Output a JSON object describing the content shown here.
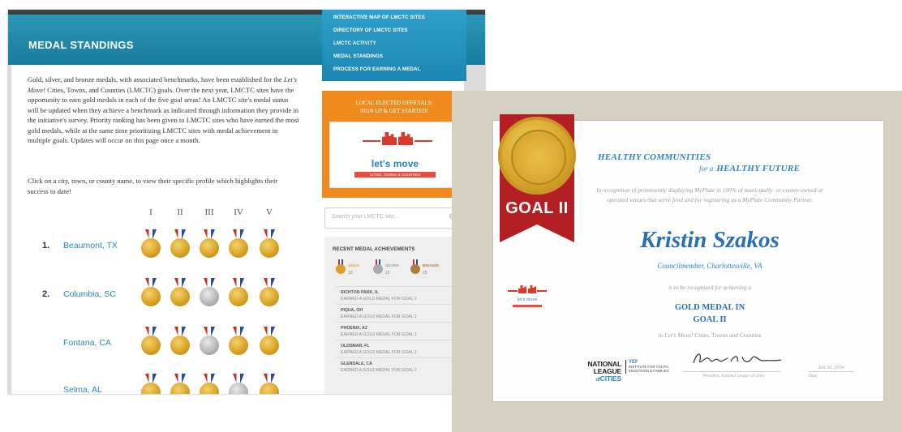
{
  "site": {
    "page_title": "MEDAL STANDINGS",
    "intro_before_italic": "Gold, silver, and bronze medals, with associated benchmarks, have been established for the ",
    "intro_italic": "Let's Move!",
    "intro_after_italic": " Cities, Towns, and Counties (LMCTC) goals. Over the next year, LMCTC sites have the opportunity to earn gold medals in each of the five goal areas! An LMCTC site's medal status will be updated when they achieve a benchmark as indicated through information they provide in the initiative's survey. Priority ranking has been given to LMCTC sites who have earned the most gold medals, while at the same time prioritizing LMCTC sites with medal achievement in multiple goals. Updates will occur on this page once a month.",
    "click_note": "Click on a city, town, or county name, to view their specific profile which highlights their success to date!",
    "goal_columns": [
      "I",
      "II",
      "III",
      "IV",
      "V"
    ],
    "standings": [
      {
        "rank": "1.",
        "place": "Beaumont, TX",
        "medals": [
          "gold",
          "gold",
          "gold",
          "gold",
          "gold"
        ]
      },
      {
        "rank": "2.",
        "place": "Columbia, SC",
        "medals": [
          "gold",
          "gold",
          "silver",
          "gold",
          "gold"
        ]
      },
      {
        "rank": "",
        "place": "Fontana, CA",
        "medals": [
          "gold",
          "gold",
          "silver",
          "gold",
          "gold"
        ]
      },
      {
        "rank": "",
        "place": "Selma, AL",
        "medals": [
          "gold",
          "gold",
          "gold",
          "silver",
          "gold"
        ]
      }
    ],
    "nav_menu": [
      "INTERACTIVE MAP OF LMCTC SITES",
      "DIRECTORY OF LMCTC SITES",
      "LMCTC ACTIVITY",
      "MEDAL STANDINGS",
      "PROCESS FOR EARNING A MEDAL"
    ],
    "promo": {
      "line1": "LOCAL ELECTED OFFICIALS:",
      "line2": "SIGN UP & GET STARTED!",
      "brand": "let's move",
      "brand_sub": "CITIES, TOWNS & COUNTIES"
    },
    "search_placeholder": "Search your LMCTC site...",
    "recent": {
      "title": "RECENT MEDAL ACHIEVEMENTS",
      "totals": [
        {
          "label": "GOLD",
          "count": "13",
          "color": "#d7a12a"
        },
        {
          "label": "SILVER",
          "count": "12",
          "color": "#9a9a9a"
        },
        {
          "label": "BRONZE",
          "count": "15",
          "color": "#b47b3c"
        }
      ],
      "items": [
        {
          "place": "RICHTON PARK, IL",
          "desc": "EARNED A GOLD MEDAL FOR GOAL 2"
        },
        {
          "place": "PIQUA, OH",
          "desc": "EARNED A GOLD MEDAL FOR GOAL 2"
        },
        {
          "place": "PHOENIX, AZ",
          "desc": "EARNED A GOLD MEDAL FOR GOAL 2"
        },
        {
          "place": "OLDSMAR, FL",
          "desc": "EARNED A GOLD MEDAL FOR GOAL 2"
        },
        {
          "place": "GLENDALE, CA",
          "desc": "EARNED A GOLD MEDAL FOR GOAL 2"
        }
      ]
    }
  },
  "certificate": {
    "seal_label": "GOAL II",
    "heading_line1": "HEALTHY COMMUNITIES",
    "heading_for": "for a",
    "heading_line2": "HEALTHY FUTURE",
    "recognition_text": "In recognition of prominently displaying MyPlate in 100% of municipally- or county-owned or operated venues that serve food and for registering as a MyPlate Community Partner.",
    "recipient": "Kristin Szakos",
    "role": "Councilmember, Charlottesville, VA",
    "to_be_recognized": "is to be recognized for achieving a",
    "award_line1": "GOLD MEDAL IN",
    "award_line2": "GOAL II",
    "program_prefix": "in",
    "program_italic": "Let's Move!",
    "program_suffix": "Cities, Towns and Counties",
    "cert_logo_text": "let's move",
    "nlc_line1": "NATIONAL",
    "nlc_line2": "LEAGUE",
    "nlc_line3": "CITIES",
    "nlc_of": "of",
    "yef_abbr": "YEF",
    "yef_text": "INSTITUTE FOR YOUTH, EDUCATION & FAMILIES",
    "signature_title": "President, National League of Cities",
    "date_value": "Jan 30, 2014",
    "date_label": "Date"
  }
}
